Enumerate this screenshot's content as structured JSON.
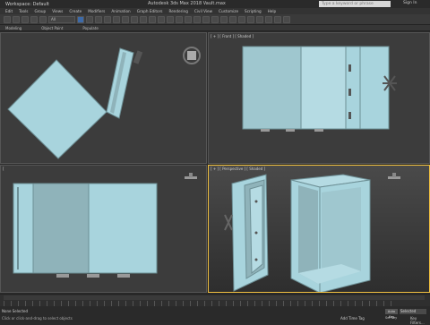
{
  "titlebar": {
    "workspace": "Workspace: Default",
    "title": "Autodesk 3ds Max 2018    Vault.max",
    "search_placeholder": "Type a keyword or phrase",
    "sign_in": "Sign In"
  },
  "menus": [
    "Edit",
    "Tools",
    "Group",
    "Views",
    "Create",
    "Modifiers",
    "Animation",
    "Graph Editors",
    "Rendering",
    "Civil View",
    "Customize",
    "Scripting",
    "Help"
  ],
  "toolbar": {
    "selection_set": "All"
  },
  "ribbon": {
    "items": [
      "Modeling",
      "Object Paint",
      "Populate"
    ]
  },
  "viewports": {
    "top_left": {
      "label": ""
    },
    "top_right": {
      "label": "[ + ] [ Front ] [ Shaded ]"
    },
    "bottom_left": {
      "label": "["
    },
    "bottom_right": {
      "label": "[ + ] [ Perspective ] [ Shaded ]"
    }
  },
  "status": {
    "line1": "None Selected",
    "line2": "Click or click-and-drag to select objects",
    "add_time_tag": "Add Time Tag",
    "auto_key": "Auto Key",
    "set_key": "Set Key",
    "selected": "Selected",
    "key_filters": "Key Filters..."
  },
  "colors": {
    "safe": "#a8d4dd",
    "safe_dark": "#8fb3ba",
    "active_border": "#f0c040"
  }
}
